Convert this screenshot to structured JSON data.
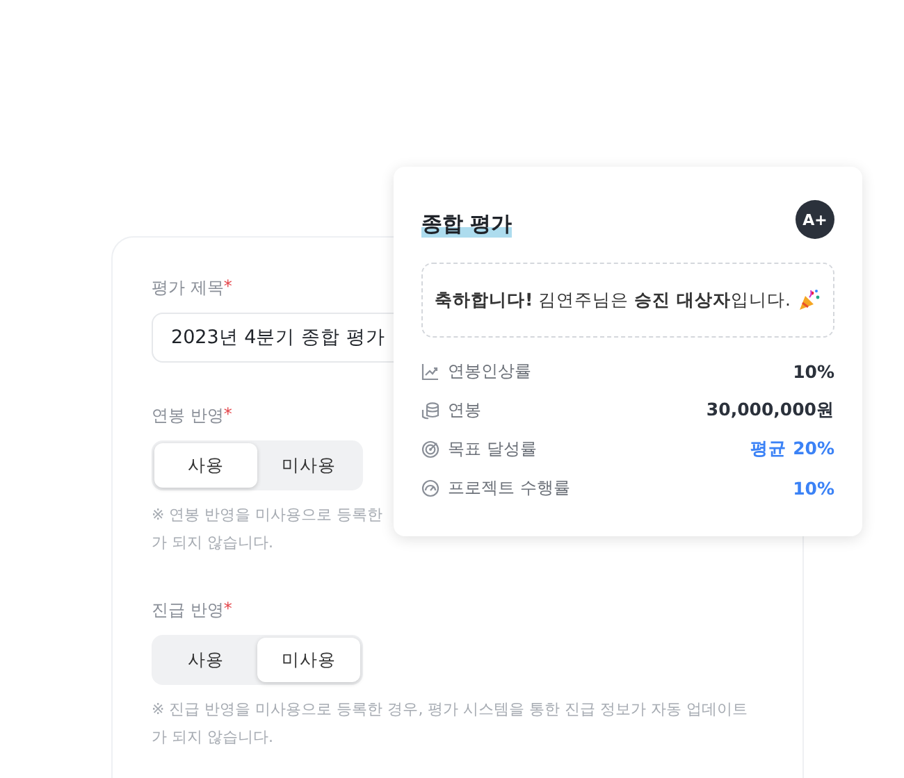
{
  "form": {
    "title_field": {
      "label": "평가 제목",
      "required_mark": "*",
      "value": "2023년 4분기 종합 평가"
    },
    "toggles": [
      {
        "label": "연봉 반영",
        "required_mark": "*",
        "options": [
          {
            "label": "사용",
            "selected": true
          },
          {
            "label": "미사용",
            "selected": false
          }
        ],
        "note_lines": [
          "※ 연봉 반영을 미사용으로 등록한",
          "가 되지 않습니다."
        ]
      },
      {
        "label": "진급 반영",
        "required_mark": "*",
        "options": [
          {
            "label": "사용",
            "selected": false
          },
          {
            "label": "미사용",
            "selected": true
          }
        ],
        "note_lines": [
          "※ 진급 반영을 미사용으로 등록한 경우, 평가 시스템을 통한 진급 정보가 자동 업데이트",
          "가 되지 않습니다."
        ]
      }
    ]
  },
  "popup": {
    "title": "종합 평가",
    "grade": "A+",
    "message": "**축하합니다!** 김연주님은 **승진 대상자**입니다.",
    "metrics": [
      {
        "kind": "trend",
        "label": "연봉인상률",
        "value": "10%",
        "accent": false
      },
      {
        "kind": "coins",
        "label": "연봉",
        "value": "30,000,000원",
        "accent": false
      },
      {
        "kind": "target",
        "label": "목표 달성률",
        "value": "평균 20%",
        "accent": true
      },
      {
        "kind": "gauge",
        "label": "프로젝트 수행률",
        "value": "10%",
        "accent": true
      }
    ]
  }
}
